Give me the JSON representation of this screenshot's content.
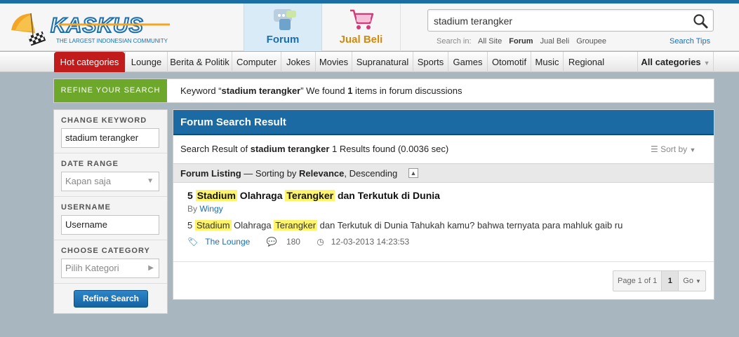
{
  "brand": {
    "name": "KASKUS",
    "tagline": "THE LARGEST INDONESIAN COMMUNITY",
    "accent": "#1a6fb0"
  },
  "nav": {
    "forum_label": "Forum",
    "jualbeli_label": "Jual Beli"
  },
  "search": {
    "query": "stadium terangker",
    "search_in_label": "Search in:",
    "options": [
      "All Site",
      "Forum",
      "Jual Beli",
      "Groupee"
    ],
    "active_option": "Forum",
    "tips_label": "Search Tips"
  },
  "categories": {
    "hot_label": "Hot categories",
    "items": [
      "Lounge",
      "Berita & Politik",
      "Computer",
      "Jokes",
      "Movies",
      "Supranatural",
      "Sports",
      "Games",
      "Otomotif",
      "Music",
      "Regional"
    ],
    "all_label": "All categories"
  },
  "refine": {
    "tag": "REFINE YOUR SEARCH",
    "msg_prefix": "Keyword “",
    "msg_keyword": "stadium terangker",
    "msg_mid": "” We found ",
    "msg_count": "1",
    "msg_suffix": " items in forum discussions"
  },
  "sidebar": {
    "change_keyword_title": "CHANGE KEYWORD",
    "keyword_value": "stadium terangker",
    "date_range_title": "DATE RANGE",
    "date_range_value": "Kapan saja",
    "username_title": "USERNAME",
    "username_value": "Username",
    "category_title": "CHOOSE CATEGORY",
    "category_value": "Pilih Kategori",
    "refine_button": "Refine Search"
  },
  "main": {
    "title": "Forum Search Result",
    "result_prefix": "Search Result of ",
    "result_keyword": "stadium terangker",
    "result_suffix": " 1 Results found (0.0036 sec)",
    "sort_label": "Sort by",
    "listing_label": "Forum Listing",
    "listing_mid": " — Sorting by ",
    "listing_sort": "Relevance",
    "listing_order": ", Descending"
  },
  "result": {
    "title_parts": [
      "5 ",
      "Stadium",
      " Olahraga ",
      "Terangker",
      " dan Terkutuk di Dunia"
    ],
    "by_label": "By",
    "author": "Wingy",
    "snippet_parts": [
      "5 ",
      "Stadium",
      " Olahraga ",
      "Terangker",
      " dan Terkutuk di Dunia Tahukah kamu? bahwa ternyata para mahluk gaib ru"
    ],
    "forum": "The Lounge",
    "replies": "180",
    "date": "12-03-2013 14:23:53"
  },
  "pager": {
    "page_text": "Page 1 of 1",
    "current": "1",
    "go_label": "Go"
  }
}
